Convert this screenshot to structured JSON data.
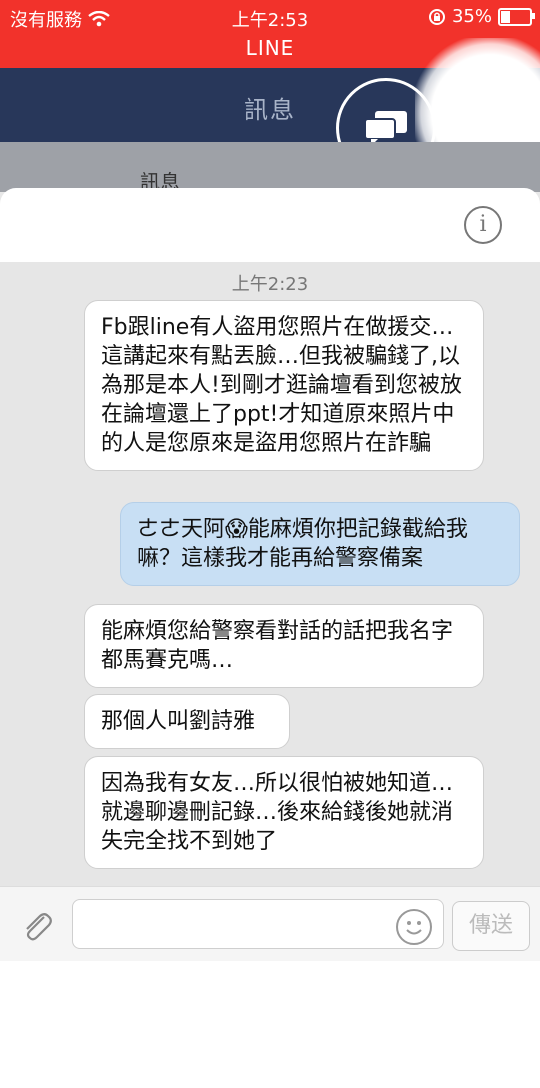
{
  "status": {
    "carrier": "沒有服務",
    "time": "上午2:53",
    "battery": "35%",
    "battery_level": 0.35
  },
  "app": {
    "title": "LINE"
  },
  "nav": {
    "title": "訊息",
    "sub": "訊息"
  },
  "chat": {
    "timestamp": "上午2:23",
    "messages": [
      {
        "dir": "in",
        "text": "Fb跟line有人盜用您照片在做援交…這講起來有點丟臉…但我被騙錢了,以為那是本人!到剛才逛論壇看到您被放在論壇還上了ppt!才知道原來照片中的人是您原來是盜用您照片在詐騙"
      },
      {
        "dir": "out",
        "text": "ㄜㄜ天阿😱能麻煩你把記錄截給我嘛？這樣我才能再給警察備案"
      },
      {
        "dir": "in",
        "text": "能麻煩您給警察看對話的話把我名字都馬賽克嗎…"
      },
      {
        "dir": "in",
        "text": "那個人叫劉詩雅"
      },
      {
        "dir": "in",
        "text": "因為我有女友…所以很怕被她知道…就邊聊邊刪記錄…後來給錢後她就消失完全找不到她了"
      }
    ]
  },
  "input": {
    "send_label": "傳送"
  },
  "icons": {
    "wifi": "wifi-icon",
    "lock": "rotation-lock-icon",
    "info": "info-icon",
    "clip": "paperclip-icon",
    "emoji": "emoji-icon",
    "chat": "chat-bubbles-icon"
  }
}
